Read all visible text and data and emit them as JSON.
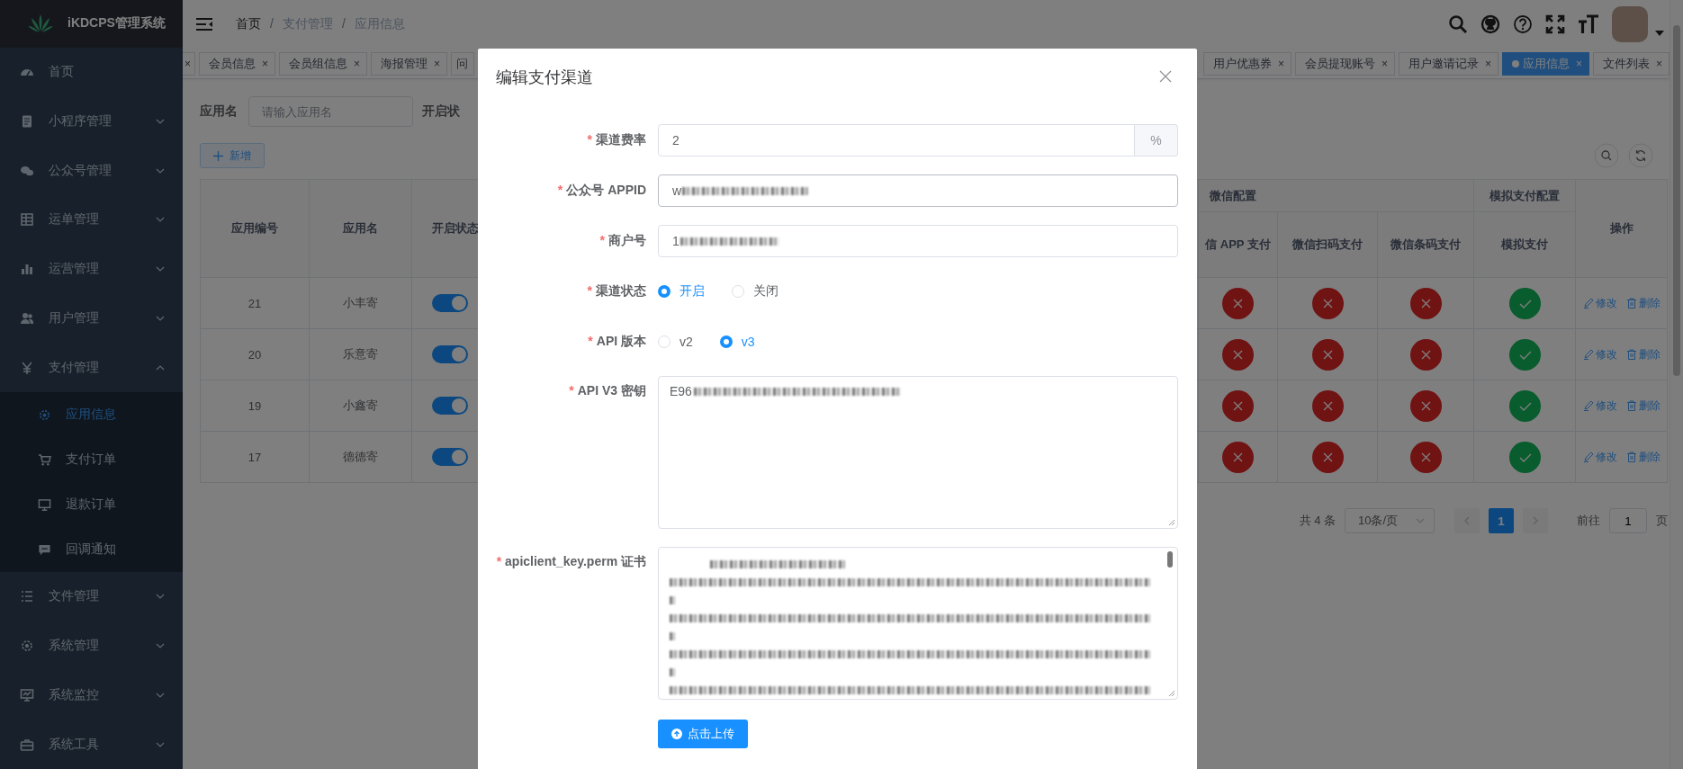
{
  "sidebar": {
    "logo_text": "iKDCPS管理系统",
    "items": [
      {
        "label": "首页",
        "kind": "link",
        "selected": false
      },
      {
        "label": "小程序管理",
        "kind": "submenu",
        "expanded": false,
        "selected": false
      },
      {
        "label": "公众号管理",
        "kind": "submenu",
        "expanded": false,
        "selected": false
      },
      {
        "label": "运单管理",
        "kind": "submenu",
        "expanded": false,
        "selected": false
      },
      {
        "label": "运营管理",
        "kind": "submenu",
        "expanded": false,
        "selected": false
      },
      {
        "label": "用户管理",
        "kind": "submenu",
        "expanded": false,
        "selected": false
      },
      {
        "label": "支付管理",
        "kind": "submenu",
        "expanded": true,
        "selected": false,
        "children": [
          {
            "label": "应用信息",
            "selected": true
          },
          {
            "label": "支付订单",
            "selected": false
          },
          {
            "label": "退款订单",
            "selected": false
          },
          {
            "label": "回调通知",
            "selected": false
          }
        ]
      },
      {
        "label": "文件管理",
        "kind": "submenu",
        "expanded": false,
        "selected": false
      },
      {
        "label": "系统管理",
        "kind": "submenu",
        "expanded": false,
        "selected": false
      },
      {
        "label": "系统监控",
        "kind": "submenu",
        "expanded": false,
        "selected": false
      },
      {
        "label": "系统工具",
        "kind": "submenu",
        "expanded": false,
        "selected": false
      }
    ]
  },
  "breadcrumbs": [
    {
      "kind": "link",
      "label": "首页"
    },
    {
      "kind": "separator",
      "label": "/"
    },
    {
      "kind": "link",
      "label": "支付管理"
    },
    {
      "kind": "separator",
      "label": "/"
    },
    {
      "kind": "current",
      "label": "应用信息"
    }
  ],
  "tabs_left": [
    {
      "close": "×",
      "selected": false
    },
    {
      "label": "会员信息",
      "close": "×",
      "selected": false
    },
    {
      "label": "会员组信息",
      "close": "×",
      "selected": false
    },
    {
      "label": "海报管理",
      "close": "×",
      "selected": false
    },
    {
      "label": "问",
      "selected": false
    }
  ],
  "tabs_right": [
    {
      "label": "用户优惠券",
      "close": "×",
      "selected": false
    },
    {
      "label": "会员提现账号",
      "close": "×",
      "selected": false
    },
    {
      "label": "用户邀请记录",
      "close": "×",
      "selected": false
    },
    {
      "label": "应用信息",
      "close": "×",
      "selected": true
    },
    {
      "label": "文件列表",
      "close": "×",
      "selected": false
    }
  ],
  "search": {
    "label": "应用名",
    "placeholder": "请输入应用名",
    "status_label": "开启状"
  },
  "add_button": "新增",
  "table": {
    "columns_before": [
      "应用编号",
      "应用名",
      "开启状态"
    ],
    "column_groups": [
      {
        "label": "微信配置",
        "columns": [
          "信 APP 支付",
          "微信扫码支付",
          "微信条码支付"
        ]
      },
      {
        "label": "模拟支付配置",
        "columns": [
          "模拟支付"
        ]
      }
    ],
    "columns_after": [
      "操作"
    ],
    "rows": [
      {
        "id": "21",
        "name": "小丰寄",
        "enabled": true,
        "flags": [
          false,
          false,
          false,
          true
        ],
        "actions": [
          "修改",
          "删除"
        ]
      },
      {
        "id": "20",
        "name": "乐意寄",
        "enabled": true,
        "flags": [
          false,
          false,
          false,
          true
        ],
        "actions": [
          "修改",
          "删除"
        ]
      },
      {
        "id": "19",
        "name": "小鑫寄",
        "enabled": true,
        "flags": [
          false,
          false,
          false,
          true
        ],
        "actions": [
          "修改",
          "删除"
        ]
      },
      {
        "id": "17",
        "name": "德德寄",
        "enabled": true,
        "flags": [
          false,
          false,
          false,
          true
        ],
        "actions": [
          "修改",
          "删除"
        ]
      }
    ]
  },
  "pagination": {
    "total": "共 4 条",
    "page_size": "10条/页",
    "pages": [
      {
        "label": "1",
        "selected": true
      }
    ],
    "goto_label": "前往",
    "goto_value": "1",
    "goto_suffix": "页"
  },
  "dialog": {
    "title": "编辑支付渠道",
    "fields": [
      {
        "kind": "input-append",
        "required_mark": "*",
        "label": "渠道费率",
        "value": "2",
        "append": "%",
        "redacted": false
      },
      {
        "kind": "input",
        "required_mark": "*",
        "label": "公众号 APPID",
        "value": "w",
        "redacted": true
      },
      {
        "kind": "input",
        "required_mark": "*",
        "label": "商户号",
        "value": "1",
        "redacted": true
      },
      {
        "kind": "radio",
        "required_mark": "*",
        "label": "渠道状态",
        "options": [
          {
            "label": "开启",
            "selected": true
          },
          {
            "label": "关闭",
            "selected": false
          }
        ]
      },
      {
        "kind": "radio",
        "required_mark": "*",
        "label": "API 版本",
        "options": [
          {
            "label": "v2",
            "selected": false
          },
          {
            "label": "v3",
            "selected": true
          }
        ]
      },
      {
        "kind": "textarea",
        "required_mark": "*",
        "label": "API V3 密钥",
        "value": "E96",
        "redacted": true
      },
      {
        "kind": "textarea",
        "required_mark": "*",
        "label": "apiclient_key.perm 证书",
        "redacted": true
      }
    ],
    "upload_button": "点击上传"
  }
}
